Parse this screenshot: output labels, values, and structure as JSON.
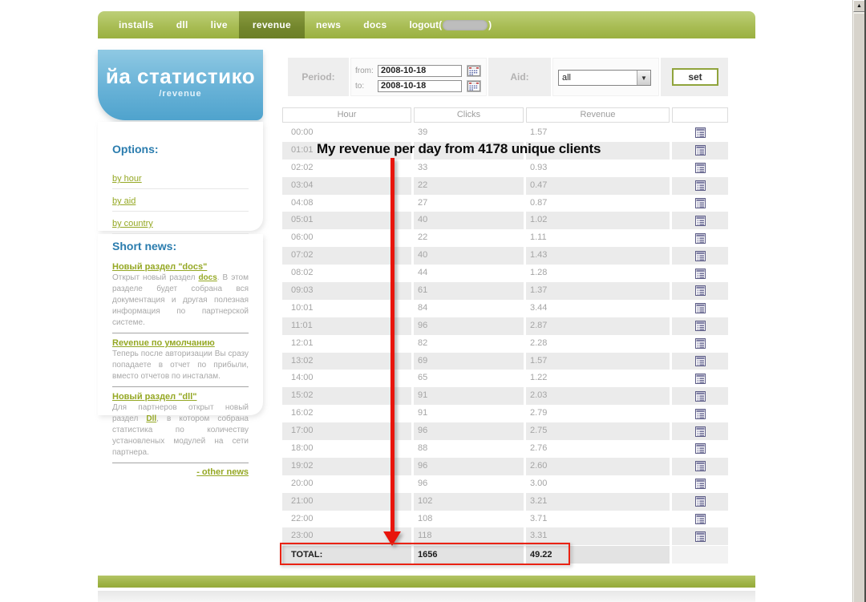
{
  "nav": {
    "items": [
      {
        "label": "installs",
        "active": false
      },
      {
        "label": "dll",
        "active": false
      },
      {
        "label": "live",
        "active": false
      },
      {
        "label": "revenue",
        "active": true
      },
      {
        "label": "news",
        "active": false
      },
      {
        "label": "docs",
        "active": false
      }
    ],
    "logout_prefix": "logout(",
    "logout_suffix": ")"
  },
  "logo": {
    "title": "йа статистико",
    "subtitle": "/revenue"
  },
  "sidebar": {
    "options": {
      "heading": "Options:",
      "links": [
        "by hour",
        "by aid",
        "by country"
      ]
    },
    "news": {
      "heading": "Short news:",
      "items": [
        {
          "title": "Новый раздел \"docs\"",
          "body1": "Открыт новый раздел ",
          "link": "docs",
          "body2": ". В этом разделе будет собрана вся документация и другая полезная информация по партнерской системе."
        },
        {
          "title": "Revenue по умолчанию",
          "body1": "Теперь после авторизации Вы сразу попадаете в отчет по прибыли, вместо отчетов по инсталам.",
          "link": "",
          "body2": ""
        },
        {
          "title": "Новый раздел \"dll\"",
          "body1": "Для партнеров открыт новый раздел ",
          "link": "Dll",
          "body2": ", в котором собрана статистика по количеству установленых модулей на сети партнера."
        }
      ],
      "more_link": "- other news"
    }
  },
  "filter": {
    "period_label": "Period:",
    "from_label": "from:",
    "from_value": "2008-10-18",
    "to_label": "to:",
    "to_value": "2008-10-18",
    "aid_label": "Aid:",
    "aid_value": "all",
    "set_label": "set"
  },
  "table": {
    "headers": [
      "Hour",
      "Clicks",
      "Revenue"
    ],
    "rows": [
      {
        "hour": "00:00",
        "clicks": "39",
        "revenue": "1.57"
      },
      {
        "hour": "01:01",
        "clicks": "",
        "revenue": ""
      },
      {
        "hour": "02:02",
        "clicks": "33",
        "revenue": "0.93"
      },
      {
        "hour": "03:04",
        "clicks": "22",
        "revenue": "0.47"
      },
      {
        "hour": "04:08",
        "clicks": "27",
        "revenue": "0.87"
      },
      {
        "hour": "05:01",
        "clicks": "40",
        "revenue": "1.02"
      },
      {
        "hour": "06:00",
        "clicks": "22",
        "revenue": "1.11"
      },
      {
        "hour": "07:02",
        "clicks": "40",
        "revenue": "1.43"
      },
      {
        "hour": "08:02",
        "clicks": "44",
        "revenue": "1.28"
      },
      {
        "hour": "09:03",
        "clicks": "61",
        "revenue": "1.37"
      },
      {
        "hour": "10:01",
        "clicks": "84",
        "revenue": "3.44"
      },
      {
        "hour": "11:01",
        "clicks": "96",
        "revenue": "2.87"
      },
      {
        "hour": "12:01",
        "clicks": "82",
        "revenue": "2.28"
      },
      {
        "hour": "13:02",
        "clicks": "69",
        "revenue": "1.57"
      },
      {
        "hour": "14:00",
        "clicks": "65",
        "revenue": "1.22"
      },
      {
        "hour": "15:02",
        "clicks": "91",
        "revenue": "2.03"
      },
      {
        "hour": "16:02",
        "clicks": "91",
        "revenue": "2.79"
      },
      {
        "hour": "17:00",
        "clicks": "96",
        "revenue": "2.75"
      },
      {
        "hour": "18:00",
        "clicks": "88",
        "revenue": "2.76"
      },
      {
        "hour": "19:02",
        "clicks": "96",
        "revenue": "2.60"
      },
      {
        "hour": "20:00",
        "clicks": "96",
        "revenue": "3.00"
      },
      {
        "hour": "21:00",
        "clicks": "102",
        "revenue": "3.21"
      },
      {
        "hour": "22:00",
        "clicks": "108",
        "revenue": "3.71"
      },
      {
        "hour": "23:00",
        "clicks": "118",
        "revenue": "3.31"
      }
    ],
    "total": {
      "label": "TOTAL:",
      "clicks": "1656",
      "revenue": "49.22"
    }
  },
  "annotation": {
    "text": "My revenue per day from 4178 unique clients"
  },
  "colors": {
    "nav_green": "#a9bd55",
    "nav_active_green": "#73862c",
    "logo_blue": "#68b2d7",
    "heading_blue": "#2a7cae",
    "link_green": "#95a824",
    "row_stripe": "#ebebeb",
    "annotation_red": "#e8150c"
  }
}
